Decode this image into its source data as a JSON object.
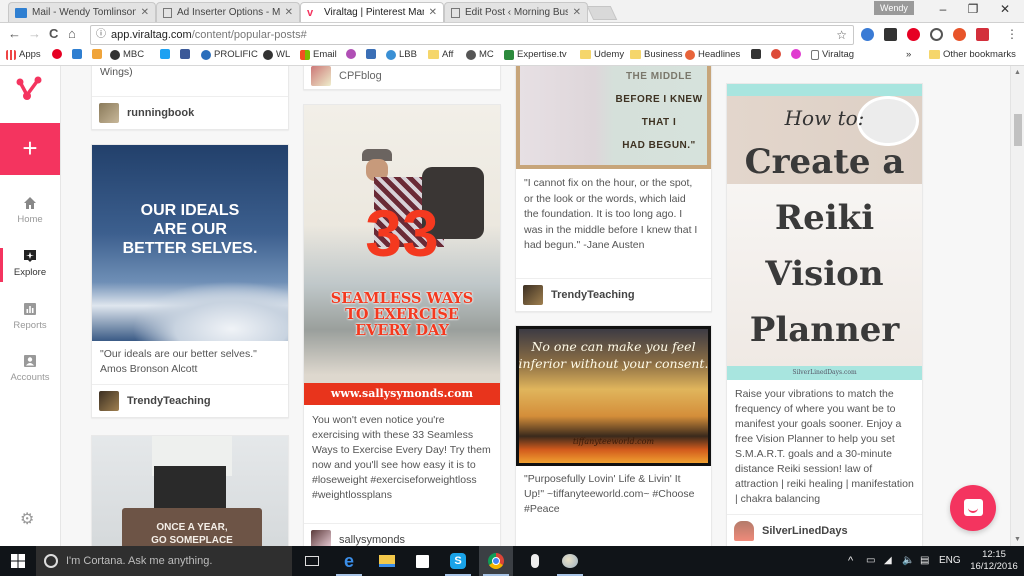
{
  "browser": {
    "tabs": [
      {
        "title": "Mail - Wendy Tomlinson",
        "icon": "mail-icon",
        "active": false
      },
      {
        "title": "Ad Inserter Options - Mo",
        "icon": "document-icon",
        "active": false
      },
      {
        "title": "Viraltag | Pinterest Mana",
        "icon": "viraltag-icon",
        "active": true
      },
      {
        "title": "Edit Post ‹ Morning Busi",
        "icon": "document-icon",
        "active": false
      }
    ],
    "profile_name": "Wendy",
    "window_controls": {
      "minimize": "–",
      "restore": "❐",
      "close": "✕"
    },
    "address": {
      "host": "app.viraltag.com",
      "path": "/content/popular-posts#"
    },
    "nav": {
      "back": "←",
      "forward": "→",
      "reload": "C",
      "home": "⌂"
    },
    "bookmark_star": "☆",
    "bookmarks": [
      {
        "label": "Apps",
        "icon": "apps-grid-icon"
      },
      {
        "label": "",
        "icon": "pinterest-icon"
      },
      {
        "label": "",
        "icon": "mail-icon"
      },
      {
        "label": "",
        "icon": "amazon-icon"
      },
      {
        "label": "MBC",
        "icon": "circle-logo-icon"
      },
      {
        "label": "",
        "icon": "twitter-icon"
      },
      {
        "label": "",
        "icon": "facebook-icon"
      },
      {
        "label": "PROLIFIC",
        "icon": "prolific-icon"
      },
      {
        "label": "WL",
        "icon": "circle-logo-icon"
      },
      {
        "label": "Email",
        "icon": "windows-icon"
      },
      {
        "label": "",
        "icon": "flower-icon"
      },
      {
        "label": "",
        "icon": "square-logo-icon"
      },
      {
        "label": "LBB",
        "icon": "circle-logo-icon"
      },
      {
        "label": "Aff",
        "icon": "folder-icon"
      },
      {
        "label": "MC",
        "icon": "mailchimp-icon"
      },
      {
        "label": "Expertise.tv",
        "icon": "tv-icon"
      },
      {
        "label": "Udemy",
        "icon": "folder-icon"
      },
      {
        "label": "Business",
        "icon": "folder-icon"
      },
      {
        "label": "Headlines",
        "icon": "headlines-icon"
      },
      {
        "label": "",
        "icon": "buffer-icon"
      },
      {
        "label": "",
        "icon": "google-plus-icon"
      },
      {
        "label": "",
        "icon": "pink-circle-icon"
      },
      {
        "label": "Viraltag",
        "icon": "document-icon"
      }
    ],
    "bookmarks_overflow": "»",
    "other_bookmarks": "Other bookmarks"
  },
  "app": {
    "brand_color": "#f4345f",
    "add_button": "+",
    "nav_items": [
      {
        "label": "Home",
        "icon": "home-icon",
        "active": false
      },
      {
        "label": "Explore",
        "icon": "explore-icon",
        "active": true
      },
      {
        "label": "Reports",
        "icon": "reports-icon",
        "active": false
      },
      {
        "label": "Accounts",
        "icon": "accounts-icon",
        "active": false
      }
    ],
    "settings_icon": "⚙"
  },
  "posts": {
    "col1": [
      {
        "description": "Wings)",
        "author": "runningbook"
      },
      {
        "image_text": "OUR IDEALS ARE OUR BETTER SELVES.",
        "description": "\"Our ideals are our better selves.\" Amos Bronson Alcott",
        "author": "TrendyTeaching"
      },
      {
        "image_text_1": "ONCE A YEAR,",
        "image_text_2": "GO SOMEPLACE"
      }
    ],
    "col2": [
      {
        "author": "CPFblog"
      },
      {
        "image_number": "33",
        "image_line_1": "SEAMLESS WAYS",
        "image_line_2": "TO EXERCISE",
        "image_line_3": "EVERY DAY",
        "image_url": "www.sallysymonds.com",
        "description": "You won't even notice you're exercising with these 33 Seamless Ways to Exercise Every Day! Try them now and you'll see how easy it is to #loseweight #exerciseforweightloss #weightlossplans",
        "author": "sallysymonds"
      }
    ],
    "col3": [
      {
        "image_lines": [
          "THE MIDDLE",
          "BEFORE I KNEW",
          "THAT I",
          "HAD BEGUN.\""
        ],
        "description": "\"I cannot fix on the hour, or the spot, or the look or the words, which laid the foundation. It is too long ago. I was in the middle before I knew that I had begun.\" -Jane Austen",
        "author": "TrendyTeaching"
      },
      {
        "image_line_1": "No one can make you feel",
        "image_line_2": "inferior without your consent.",
        "image_site": "tiffanyteeworld.com",
        "description": "\"Purposefully Lovin' Life & Livin' It Up!\" ~tiffanyteeworld.com~ #Choose #Peace"
      }
    ],
    "col4": [
      {
        "image_how": "How to:",
        "image_title": [
          "Create a",
          "Reiki",
          "Vision",
          "Planner"
        ],
        "image_site": "SilverLinedDays.com",
        "description": "Raise your vibrations to match the frequency of where you want be to manifest your goals sooner. Enjoy a free Vision Planner to help you set S.M.A.R.T. goals and a 30-minute distance Reiki session! law of attraction | reiki healing | manifestation | chakra balancing",
        "author": "SilverLinedDays"
      }
    ]
  },
  "taskbar": {
    "cortana_placeholder": "I'm Cortana. Ask me anything.",
    "apps": [
      "task-view",
      "edge",
      "file-explorer",
      "store",
      "skype",
      "chrome",
      "voice-recorder",
      "paint"
    ],
    "tray": {
      "chevron": "^",
      "language": "ENG"
    },
    "time": "12:15",
    "date": "16/12/2016"
  }
}
